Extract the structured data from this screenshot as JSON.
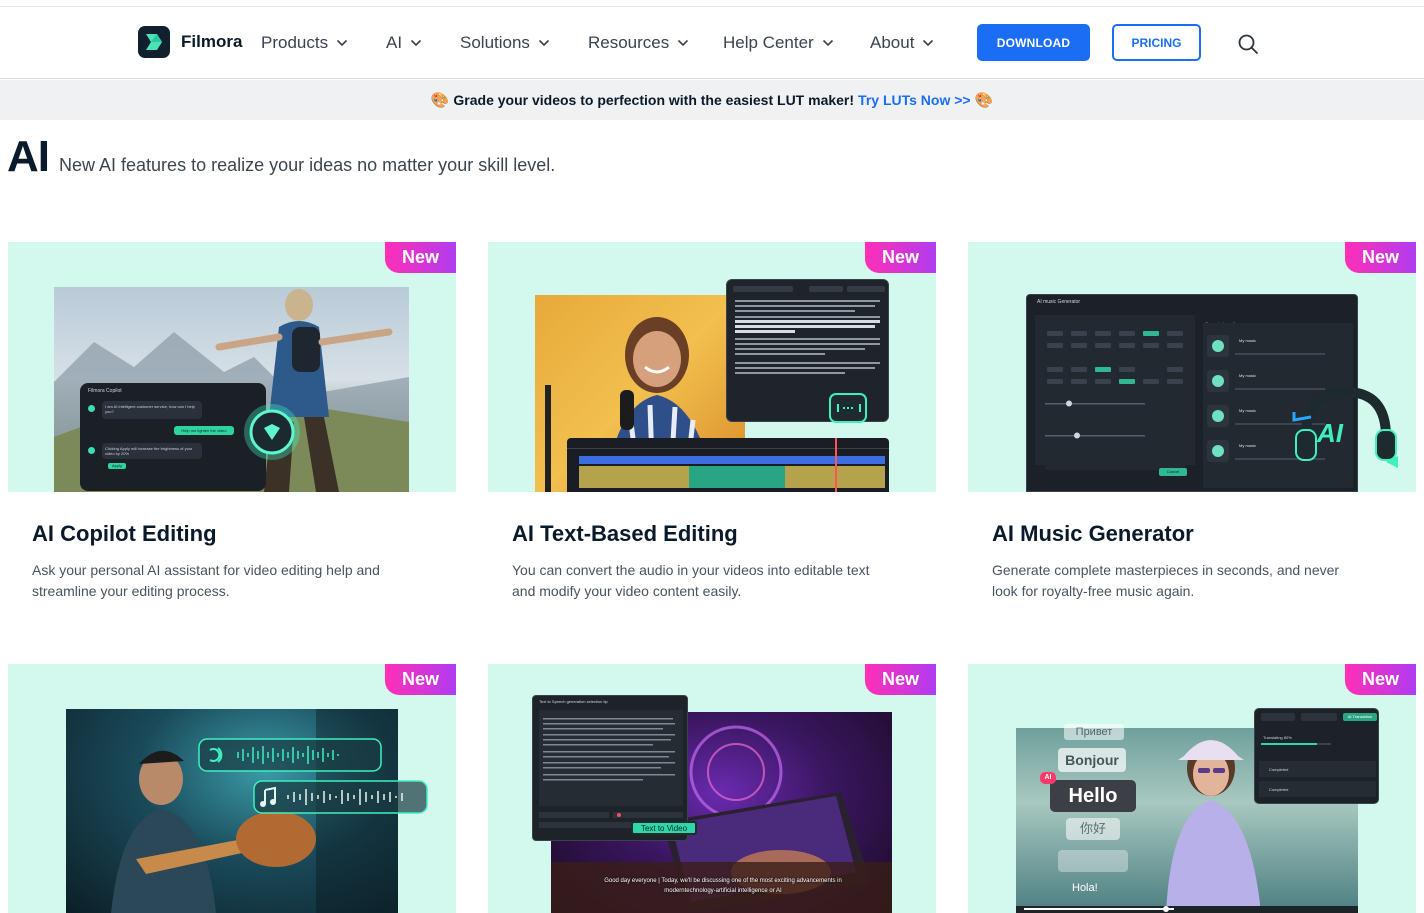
{
  "header": {
    "logo_text": "Filmora",
    "nav": [
      {
        "label": "Products"
      },
      {
        "label": "AI"
      },
      {
        "label": "Solutions"
      },
      {
        "label": "Resources"
      },
      {
        "label": "Help Center"
      },
      {
        "label": "About"
      }
    ],
    "download_label": "DOWNLOAD",
    "pricing_label": "PRICING",
    "search_icon": "search-icon"
  },
  "promo": {
    "text": "Grade your videos to perfection with the easiest LUT maker!",
    "link": "Try LUTs Now >>",
    "emoji": "🎨"
  },
  "page": {
    "title": "AI",
    "subtitle": "New AI features to realize your ideas no matter your skill level."
  },
  "cards": [
    {
      "badge": "New",
      "title": "AI Copilot Editing",
      "desc": "Ask your personal AI assistant for video editing help and streamline your editing process."
    },
    {
      "badge": "New",
      "title": "AI Text-Based Editing",
      "desc": "You can convert the audio in your videos into editable text and modify your video content easily."
    },
    {
      "badge": "New",
      "title": "AI Music Generator",
      "desc": "Generate complete masterpieces in seconds, and never look for royalty-free music again."
    },
    {
      "badge": "New"
    },
    {
      "badge": "New"
    },
    {
      "badge": "New"
    }
  ],
  "card_art": {
    "copilot_panel_title": "Filmora Copilot",
    "copilot_msg1": "I am AI intelligent customer service, how can I help you?",
    "copilot_reply": "Help me lighten the video",
    "copilot_msg2": "Clicking Apply will increase the brightness of your video by 20%",
    "copilot_apply": "Apply",
    "music_panel_title": "AI music Generator",
    "music_results_title": "Generated results",
    "music_track": "My music",
    "music_cancel": "Cancel",
    "music_ai_label": "AI",
    "tts_panel_title": "Text to Speech generation selection tip",
    "tts_button": "Text to Video",
    "tts_caption": "Good day everyone | Today, we'll be discussing one of the most exciting advancements in moderntechnology-artificial intelligence or AI",
    "translate_words": [
      "Привет",
      "Bonjour",
      "Hello",
      "你好",
      "Hola!"
    ],
    "translate_badge": "AI",
    "translate_tab": "AI Translation",
    "translate_status_1": "Translating 80%",
    "translate_status_2": "Completed",
    "translate_status_3": "Completed"
  },
  "colors": {
    "accent": "#1b6ef3",
    "card_bg": "#d3f8ee",
    "badge_start": "#ff2fb6",
    "badge_end": "#b03cf0",
    "ai_green": "#2de0b0"
  }
}
